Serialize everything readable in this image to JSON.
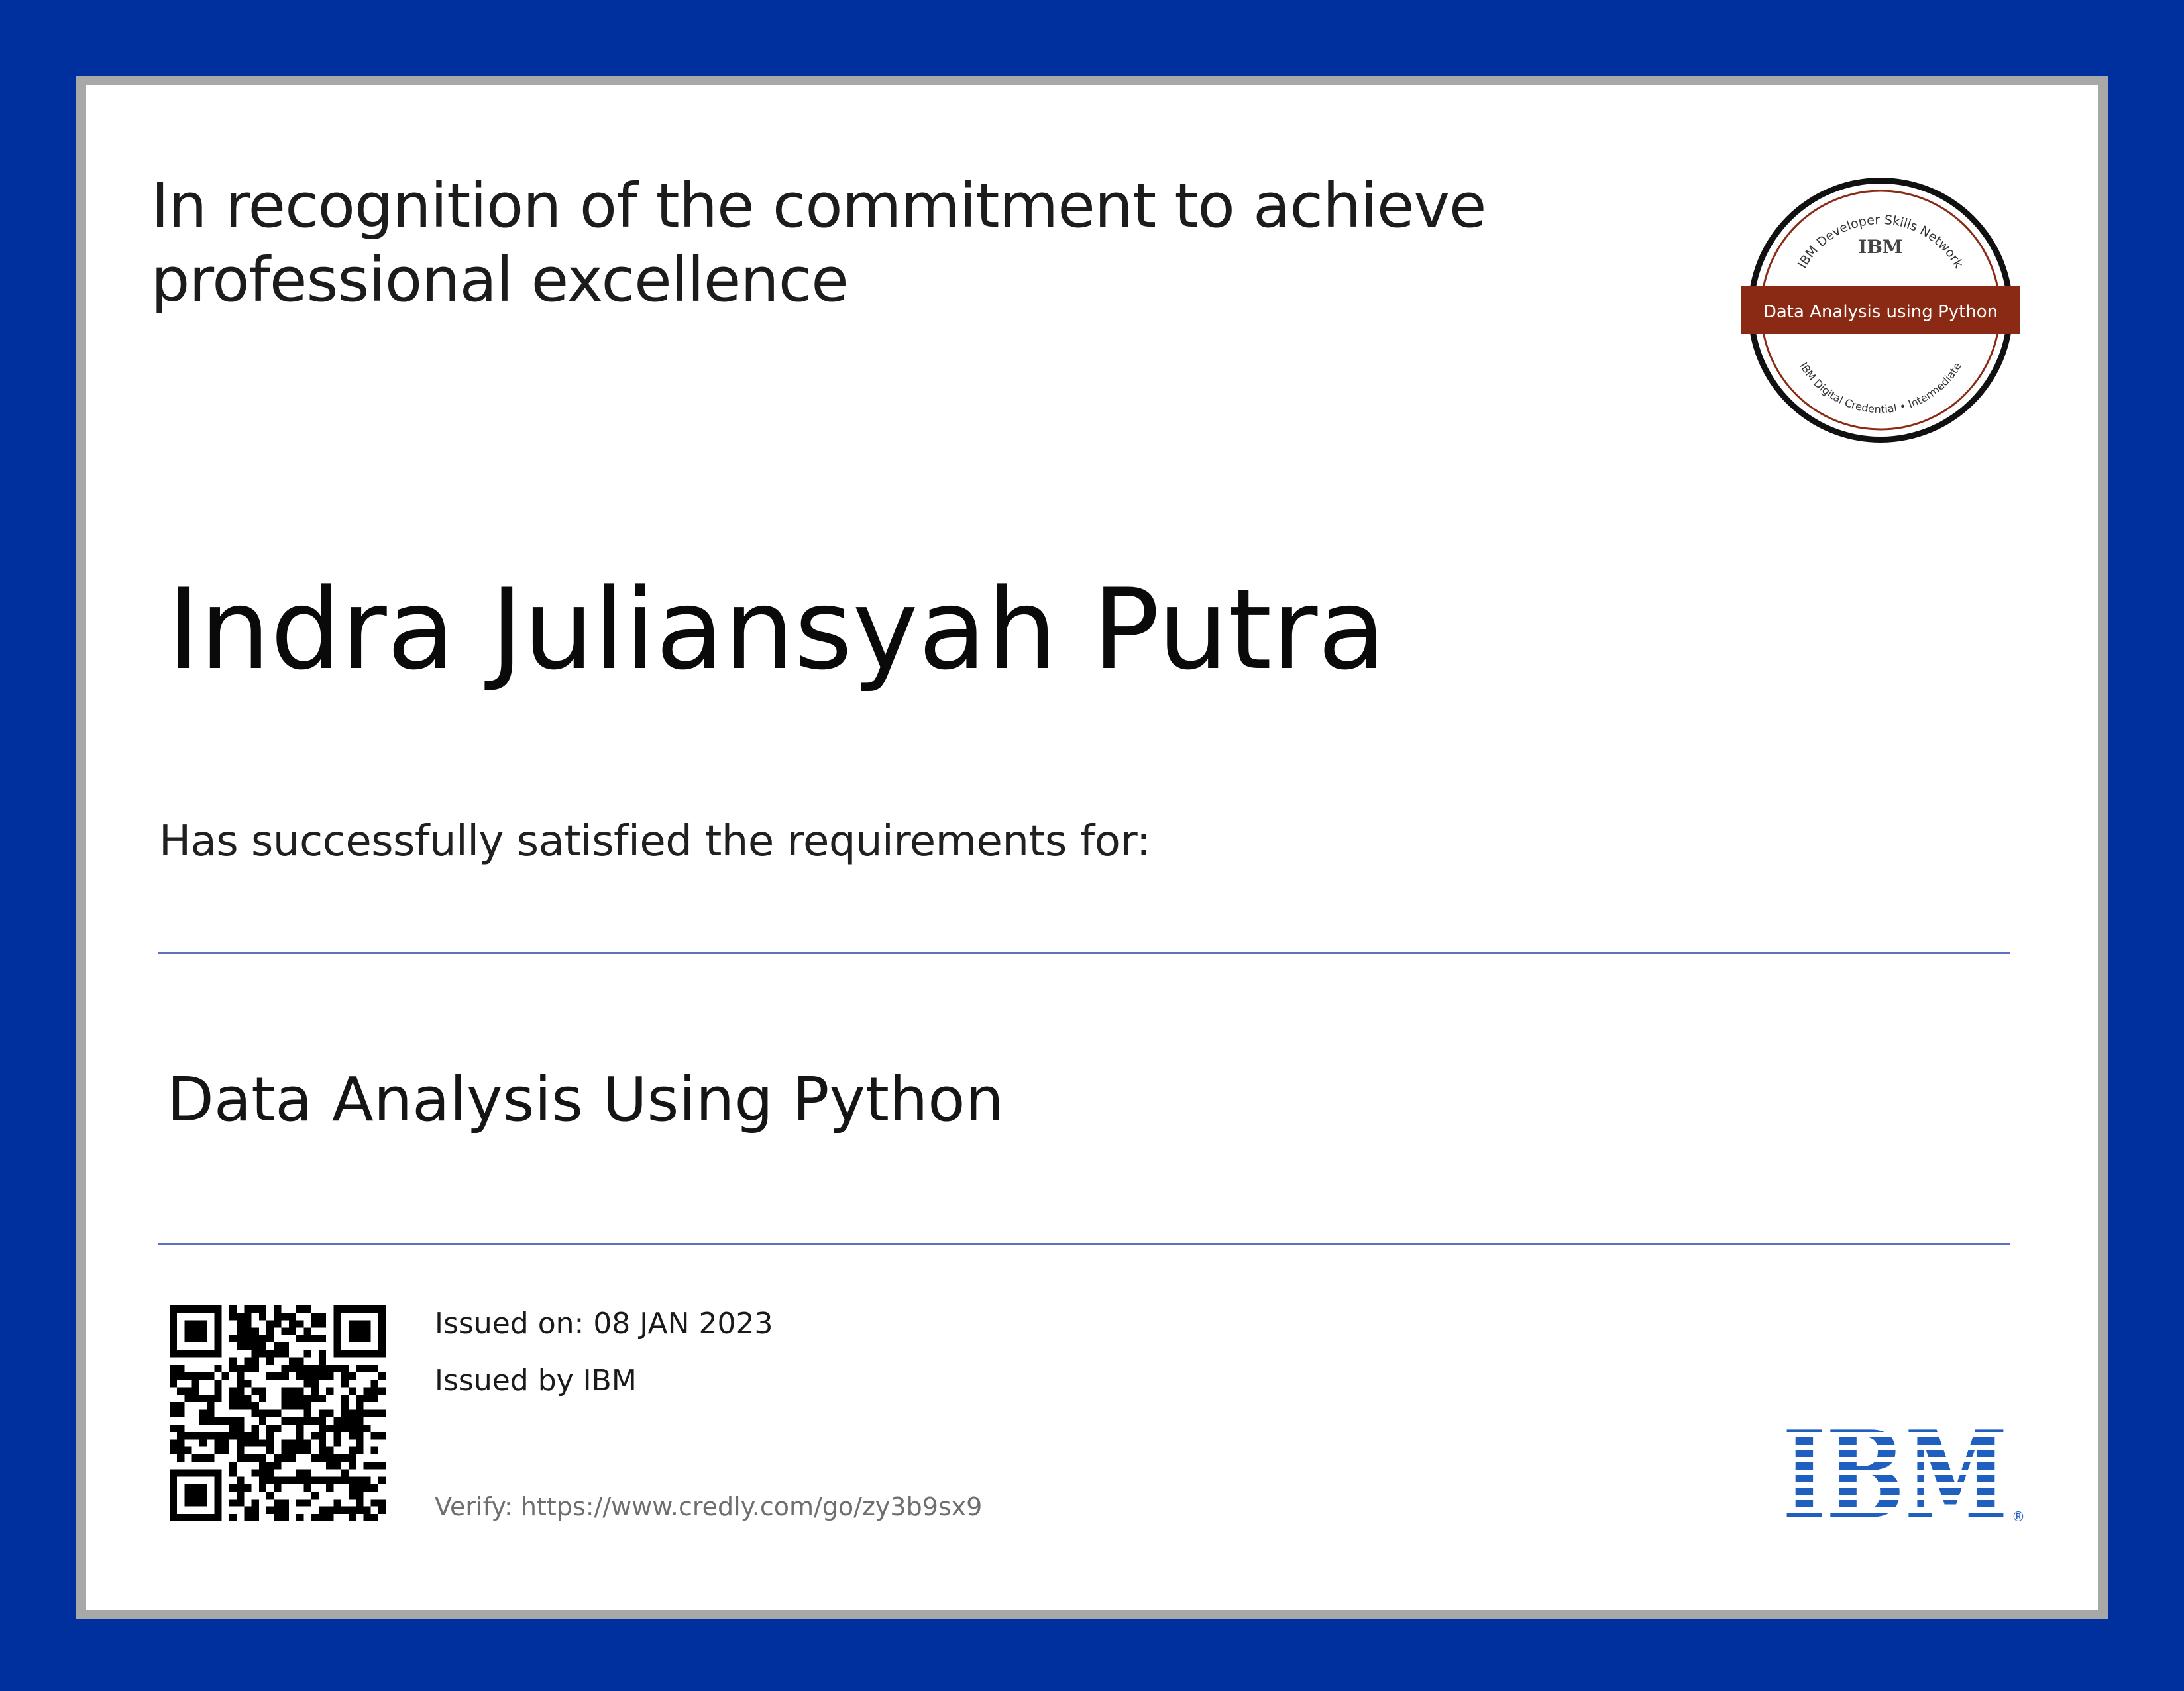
{
  "certificate": {
    "headline": "In recognition of the commitment to achieve professional excellence",
    "recipient_name": "Indra Juliansyah Putra",
    "satisfied_text": "Has successfully satisfied the requirements for:",
    "course_title": "Data Analysis Using Python",
    "issued_on": "Issued on: 08 JAN 2023",
    "issued_by": "Issued by IBM",
    "verify": "Verify: https://www.credly.com/go/zy3b9sx9"
  },
  "badge": {
    "top_arc_text": "IBM Developer Skills Network",
    "center_logo": "IBM",
    "ribbon_text": "Data Analysis using Python",
    "bottom_arc_text": "IBM Digital Credential • Intermediate",
    "ribbon_color": "#8a2a14"
  },
  "logo": {
    "text": "IBM",
    "registered_mark": "®",
    "color": "#1f5fbf"
  },
  "colors": {
    "border": "#00309e",
    "frame": "#a8a8a8",
    "rule": "#5f70c2"
  }
}
